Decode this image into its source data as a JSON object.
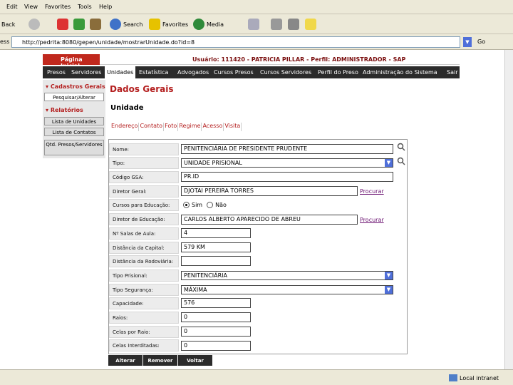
{
  "browser": {
    "menu": [
      "Edit",
      "View",
      "Favorites",
      "Tools",
      "Help"
    ],
    "toolbar": {
      "back": "Back",
      "search": "Search",
      "favorites": "Favorites",
      "media": "Media"
    },
    "address": "http://pedrita:8080/gepen/unidade/mostrarUnidade.do?id=8",
    "address_label": "ess",
    "go_label": "Go",
    "status_zone": "Local intranet"
  },
  "header": {
    "home": "Página Inicial",
    "user_info": "Usuário: 111420 - PATRICIA PILLAR - Perfil: ADMINISTRADOR - SAP"
  },
  "nav": [
    "Presos",
    "Servidores",
    "Unidades",
    "Estatística",
    "Advogados",
    "Cursos Presos",
    "Cursos Servidores",
    "Perfil do Preso",
    "Administração do Sistema",
    "Sair"
  ],
  "sidebar": {
    "cadastros": "Cadastros Gerais",
    "pesquisar": "Pesquisar/Alterar",
    "relatorios": "Relatórios",
    "items": [
      "Lista de Unidades",
      "Lista de Contatos",
      "Qtd. Presos/Servidores"
    ]
  },
  "page": {
    "title": "Dados Gerais",
    "subtitle": "Unidade",
    "tabs": [
      "Endereço",
      "Contato",
      "Foto",
      "Regime",
      "Acesso",
      "Visita"
    ]
  },
  "form": {
    "labels": {
      "nome": "Nome:",
      "tipo": "Tipo:",
      "codigo": "Código GSA:",
      "diretor_geral": "Diretor Geral:",
      "cursos": "Cursos para Educação:",
      "diretor_educacao": "Diretor de Educação:",
      "salas": "Nº Salas de Aula:",
      "distancia": "Distância da Capital:",
      "dist_rodoviaria": "Distância da Rodoviária:",
      "tipo_prisional": "Tipo Prisional:",
      "tipo_seguranca": "Tipo Segurança:",
      "capacidade": "Capacidade:",
      "raios": "Raios:",
      "celas_raio": "Celas por Raio:",
      "celas_interditadas": "Celas Interditadas:"
    },
    "values": {
      "nome": "PENITENCIÁRIA DE PRESIDENTE PRUDENTE",
      "tipo": "UNIDADE PRISIONAL",
      "codigo": "PR.ID",
      "diretor_geral": "DJOTAI PEREIRA TORRES",
      "diretor_educacao": "CARLOS ALBERTO APARECIDO DE ABREU",
      "salas": "4",
      "distancia": "579 KM",
      "dist_rodoviaria": "",
      "tipo_prisional": "PENITENCIÁRIA",
      "tipo_seguranca": "MÁXIMA",
      "capacidade": "576",
      "raios": "0",
      "celas_raio": "0",
      "celas_interditadas": "0"
    },
    "radio_sim": "Sim",
    "radio_nao": "Não",
    "procurar": "Procurar"
  },
  "buttons": {
    "alterar": "Alterar",
    "remover": "Remover",
    "voltar": "Voltar"
  }
}
